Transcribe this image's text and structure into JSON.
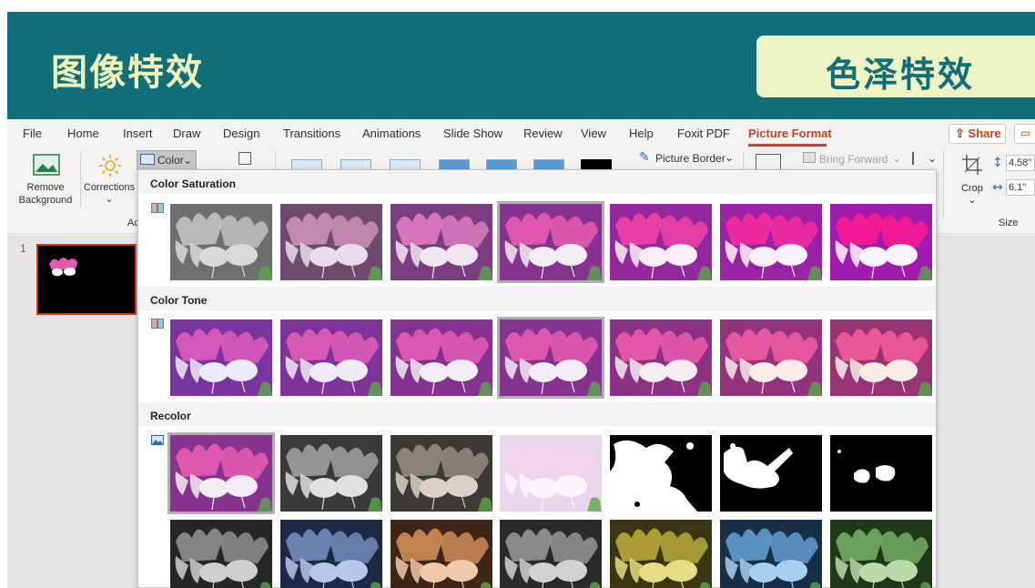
{
  "banner": {
    "title": "图像特效",
    "subtitle": "色泽特效"
  },
  "menu": {
    "tabs": [
      "File",
      "Home",
      "Insert",
      "Draw",
      "Design",
      "Transitions",
      "Animations",
      "Slide Show",
      "Review",
      "View",
      "Help",
      "Foxit PDF",
      "Picture Format"
    ],
    "active_tab": "Picture Format",
    "share_label": "Share"
  },
  "ribbon": {
    "remove_background_line1": "Remove",
    "remove_background_line2": "Background",
    "corrections_label": "Corrections",
    "color_label": "Color",
    "group_label_adjust": "Ac",
    "picture_border_label": "Picture Border",
    "bring_forward_label": "Bring Forward",
    "crop_label": "Crop",
    "height_value": "4.58\"",
    "width_value": "6.1\"",
    "size_group_label": "Size"
  },
  "slides": {
    "current_number": "1"
  },
  "gallery": {
    "sections": [
      {
        "title": "Color Saturation",
        "items": [
          {
            "tint": "#6f6f6f",
            "flower": "#d9d9d9",
            "petal": "#bdbdbd",
            "opacity": 1
          },
          {
            "tint": "#6e4a6e",
            "flower": "#e8dde8",
            "petal": "#c98bb8",
            "opacity": 1
          },
          {
            "tint": "#7a3d82",
            "flower": "#f0e6f0",
            "petal": "#d979b9",
            "opacity": 1
          },
          {
            "tint": "#86328f",
            "flower": "#f4ecf4",
            "petal": "#e25ab0",
            "opacity": 1
          },
          {
            "tint": "#92289c",
            "flower": "#f7eef7",
            "petal": "#ec3fa8",
            "opacity": 1
          },
          {
            "tint": "#9a22a6",
            "flower": "#f9f1f9",
            "petal": "#f22b9f",
            "opacity": 1
          },
          {
            "tint": "#a11aae",
            "flower": "#faf3fa",
            "petal": "#f81a96",
            "opacity": 1
          }
        ],
        "selected_index": 3
      },
      {
        "title": "Color Tone",
        "items": [
          {
            "tint": "#7a34a0",
            "flower": "#ecebf7",
            "petal": "#d95bbd",
            "opacity": 1
          },
          {
            "tint": "#7e3398",
            "flower": "#efebf5",
            "petal": "#dd5bb7",
            "opacity": 1
          },
          {
            "tint": "#833290",
            "flower": "#f2ecf3",
            "petal": "#e05ab2",
            "opacity": 1
          },
          {
            "tint": "#86328f",
            "flower": "#f4ecf4",
            "petal": "#e25ab0",
            "opacity": 1
          },
          {
            "tint": "#8c3285",
            "flower": "#f6ecef",
            "petal": "#e65aa8",
            "opacity": 1
          },
          {
            "tint": "#92337c",
            "flower": "#f8ece9",
            "petal": "#ea5aa0",
            "opacity": 1
          },
          {
            "tint": "#983475",
            "flower": "#faece4",
            "petal": "#ee5a98",
            "opacity": 1
          }
        ],
        "selected_index": 3
      },
      {
        "title": "Recolor",
        "items": [
          {
            "tint": "#86328f",
            "flower": "#f4ecf4",
            "petal": "#e25ab0",
            "opacity": 1
          },
          {
            "tint": "#3a3a3a",
            "flower": "#e0e0e0",
            "petal": "#9a9a9a",
            "opacity": 1
          },
          {
            "tint": "#3d3a36",
            "flower": "#d8d2cb",
            "petal": "#8f877f",
            "opacity": 1
          },
          {
            "tint": "#e9d6ea",
            "flower": "#fbf6fb",
            "petal": "#f3d4ea",
            "opacity": 1
          },
          {
            "tint": "#000000",
            "flower": "#ffffff",
            "petal": "#ffffff",
            "opacity": 1,
            "mode": "bw1"
          },
          {
            "tint": "#000000",
            "flower": "#ffffff",
            "petal": "#ffffff",
            "opacity": 1,
            "mode": "bw2"
          },
          {
            "tint": "#000000",
            "flower": "#ffffff",
            "petal": "#ffffff",
            "opacity": 1,
            "mode": "bw3"
          },
          {
            "tint": "#262626",
            "flower": "#cfcfcf",
            "petal": "#8a8a8a",
            "opacity": 1
          },
          {
            "tint": "#1d2a44",
            "flower": "#b7c8ea",
            "petal": "#6f86b8",
            "opacity": 1
          },
          {
            "tint": "#3f2616",
            "flower": "#f0c9a8",
            "petal": "#c78654",
            "opacity": 1
          },
          {
            "tint": "#2a2a2a",
            "flower": "#d2d2d2",
            "petal": "#8f8f8f",
            "opacity": 1
          },
          {
            "tint": "#3a3512",
            "flower": "#e6dc82",
            "petal": "#b2a43a",
            "opacity": 1
          },
          {
            "tint": "#173048",
            "flower": "#a8d0f0",
            "petal": "#5f97c6",
            "opacity": 1
          },
          {
            "tint": "#1e3818",
            "flower": "#b7dcaa",
            "petal": "#6fa65e",
            "opacity": 1
          }
        ],
        "selected_index": 0
      }
    ]
  }
}
